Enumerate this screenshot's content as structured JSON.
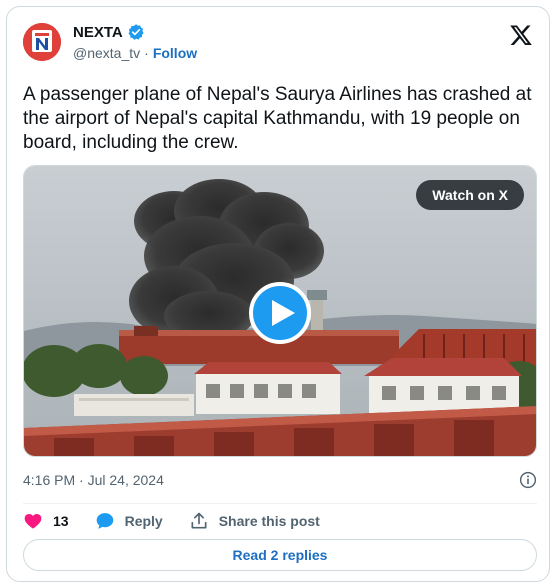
{
  "author": {
    "name": "NEXTA",
    "handle": "@nexta_tv",
    "separator": "·",
    "follow_label": "Follow",
    "avatar_letter": "N"
  },
  "tweet": {
    "text": "A passenger plane of Nepal's Saurya Airlines has crashed at the airport of Nepal's capital Kathmandu, with 19 people on board, including the crew.",
    "timestamp": "4:16 PM · Jul 24, 2024"
  },
  "media": {
    "watch_label": "Watch on X",
    "type": "video"
  },
  "actions": {
    "like_count": "13",
    "reply_label": "Reply",
    "share_label": "Share this post"
  },
  "footer": {
    "read_replies_label": "Read 2 replies"
  },
  "colors": {
    "like": "#f91880",
    "reply": "#1d9bf0",
    "link": "#1d6fc2",
    "brand_red": "#e0403a",
    "verified": "#1d9bf0"
  },
  "icons": {
    "platform": "x-logo-icon",
    "verified": "verified-badge-icon",
    "play": "play-icon",
    "info": "info-icon",
    "like": "heart-icon",
    "reply": "reply-bubble-icon",
    "share": "share-icon"
  }
}
